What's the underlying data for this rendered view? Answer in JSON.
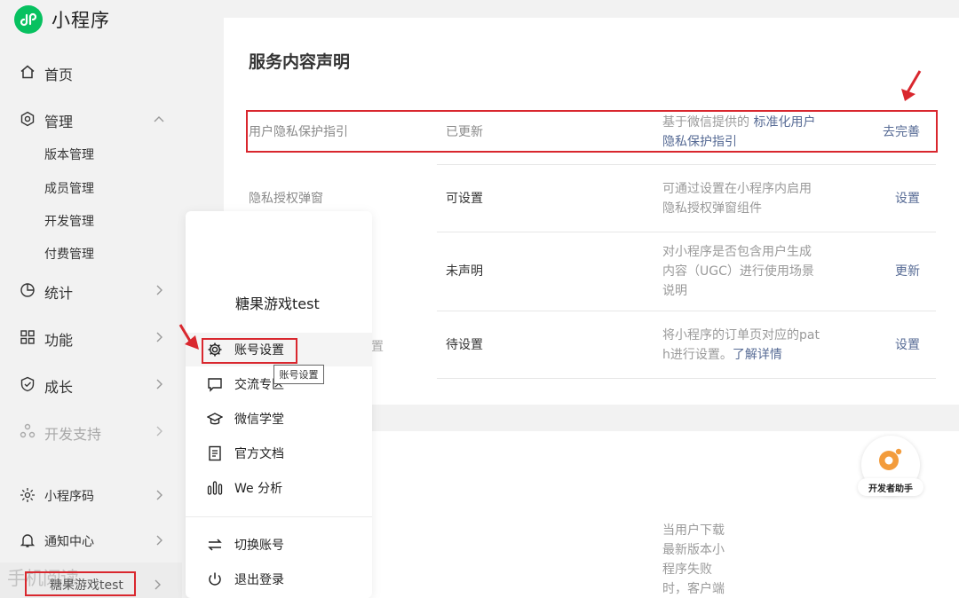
{
  "app": {
    "title": "小程序"
  },
  "sidebar": {
    "items": [
      {
        "label": "首页",
        "icon": "home-icon"
      },
      {
        "label": "管理",
        "icon": "settings-hexagon-icon",
        "expanded": true
      },
      {
        "label": "统计",
        "icon": "pie-chart-icon"
      },
      {
        "label": "功能",
        "icon": "grid-icon"
      },
      {
        "label": "成长",
        "icon": "shield-icon"
      },
      {
        "label": "开发支持",
        "icon": "nodes-icon",
        "disabled": true
      },
      {
        "label": "小程序码",
        "icon": "sun-code-icon"
      },
      {
        "label": "通知中心",
        "icon": "bell-icon"
      }
    ],
    "sub_items": [
      "版本管理",
      "成员管理",
      "开发管理",
      "付费管理"
    ],
    "account_label": "糖果游戏test",
    "watermark": "手机阅读"
  },
  "section": {
    "title": "服务内容声明",
    "rows": [
      {
        "name": "用户隐私保护指引",
        "status": "已更新",
        "desc_prefix": "基于微信提供的 ",
        "desc_link": "标准化用户",
        "desc_link2": "隐私保护指引",
        "action": "去完善"
      },
      {
        "name": "隐私授权弹窗",
        "status": "可设置",
        "desc1": "可通过设置在小程序内启用",
        "desc2": "隐私授权弹窗组件",
        "action": "设置"
      },
      {
        "status": "未声明",
        "desc1": "对小程序是否包含用户生成",
        "desc2": "内容（UGC）进行使用场景",
        "desc3": "说明",
        "action": "更新"
      },
      {
        "name_tail": "置",
        "status": "待设置",
        "desc1": "将小程序的订单页对应的pat",
        "desc2": "h进行设置。",
        "desc_link": "了解详情",
        "action": "设置"
      }
    ]
  },
  "lower": {
    "lines": [
      "当用户下载",
      "最新版本小",
      "程序失败",
      "时，客户端"
    ]
  },
  "popup": {
    "account_name": "糖果游戏test",
    "items": [
      {
        "label": "账号设置",
        "icon": "gear-icon"
      },
      {
        "label": "交流专区",
        "icon": "chat-icon"
      },
      {
        "label": "微信学堂",
        "icon": "graduation-cap-icon"
      },
      {
        "label": "官方文档",
        "icon": "document-icon"
      },
      {
        "label": "We 分析",
        "icon": "analytics-icon"
      }
    ],
    "bottom_items": [
      {
        "label": "切换账号",
        "icon": "switch-arrows-icon"
      },
      {
        "label": "退出登录",
        "icon": "power-icon"
      }
    ],
    "tooltip": "账号设置"
  },
  "helper": {
    "label": "开发者助手"
  },
  "colors": {
    "brand": "#07c160",
    "link": "#576b95",
    "annotation": "#d9272e"
  }
}
